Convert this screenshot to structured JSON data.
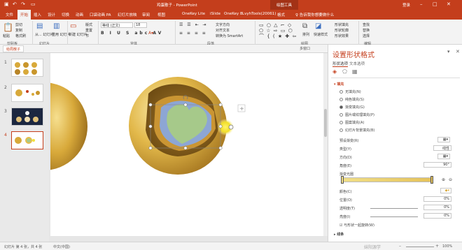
{
  "titlebar": {
    "title": "鸡蛋散子 - PowerPoint",
    "context": "绘图工具",
    "account": "登录"
  },
  "tabs": [
    "文件",
    "开始",
    "插入",
    "设计",
    "切换",
    "动画",
    "口袋动画 PA",
    "幻灯片放映",
    "审阅",
    "视图",
    "OneKey Lite",
    "iSlide",
    "OneKey 8",
    "LvyhTools(20061)",
    "格式",
    "♀ 告诉我你想要做什么"
  ],
  "active_tab": "开始",
  "ribbon": {
    "paste": "粘贴",
    "cut": "剪切",
    "copy": "复制",
    "format_painter": "格式刷",
    "clipboard": "剪贴板",
    "slide_from_outline": "从... 幻灯片",
    "reuse": "重用 幻灯片",
    "reuse_group": "幻灯片",
    "new_slide": "新建 幻灯片",
    "layout": "版式",
    "reset": "重置",
    "section": "节",
    "font_name": "等线 (正文)",
    "font_size": "18",
    "font_group": "字体",
    "text_direction": "文字方向",
    "align_text": "对齐文本",
    "smartart": "转换为 SmartArt",
    "para_group": "段落",
    "arrange": "排列",
    "quick_styles": "快速样式",
    "drawing_group": "绘图",
    "fill": "形状填充",
    "outline": "形状轮廓",
    "effects": "形状效果",
    "find": "查找",
    "replace": "替换",
    "select": "选择",
    "edit_group": "编辑"
  },
  "bar2": {
    "doc": "给局散子",
    "multi": "多窗口"
  },
  "thumbs": [
    "1",
    "2",
    "3",
    "4"
  ],
  "panel": {
    "title": "设置形状格式",
    "tab1": "形状选项",
    "tab2": "文本选项",
    "fill_header": "填充",
    "options": [
      "无填充(N)",
      "纯色填充(S)",
      "渐变填充(G)",
      "图片或纹理填充(P)",
      "图案填充(A)",
      "幻灯片背景填充(B)"
    ],
    "preset": "预设渐变(R)",
    "type": "类型(Y)",
    "type_val": "线性",
    "direction": "方向(D)",
    "angle": "角度(E)",
    "angle_val": "90°",
    "stops": "渐变光圈",
    "color": "颜色(C)",
    "position": "位置(O)",
    "position_val": "0%",
    "transparency": "透明度(T)",
    "transparency_val": "0%",
    "brightness": "亮度(I)",
    "brightness_val": "0%",
    "rotate": "与形状一起旋转(W)",
    "line": "线条"
  },
  "status": {
    "slide": "幻灯片 第 4 张，共 4 张",
    "lang": "中文(中国)",
    "zoom": "100%"
  },
  "watermark": "妹阳源学"
}
